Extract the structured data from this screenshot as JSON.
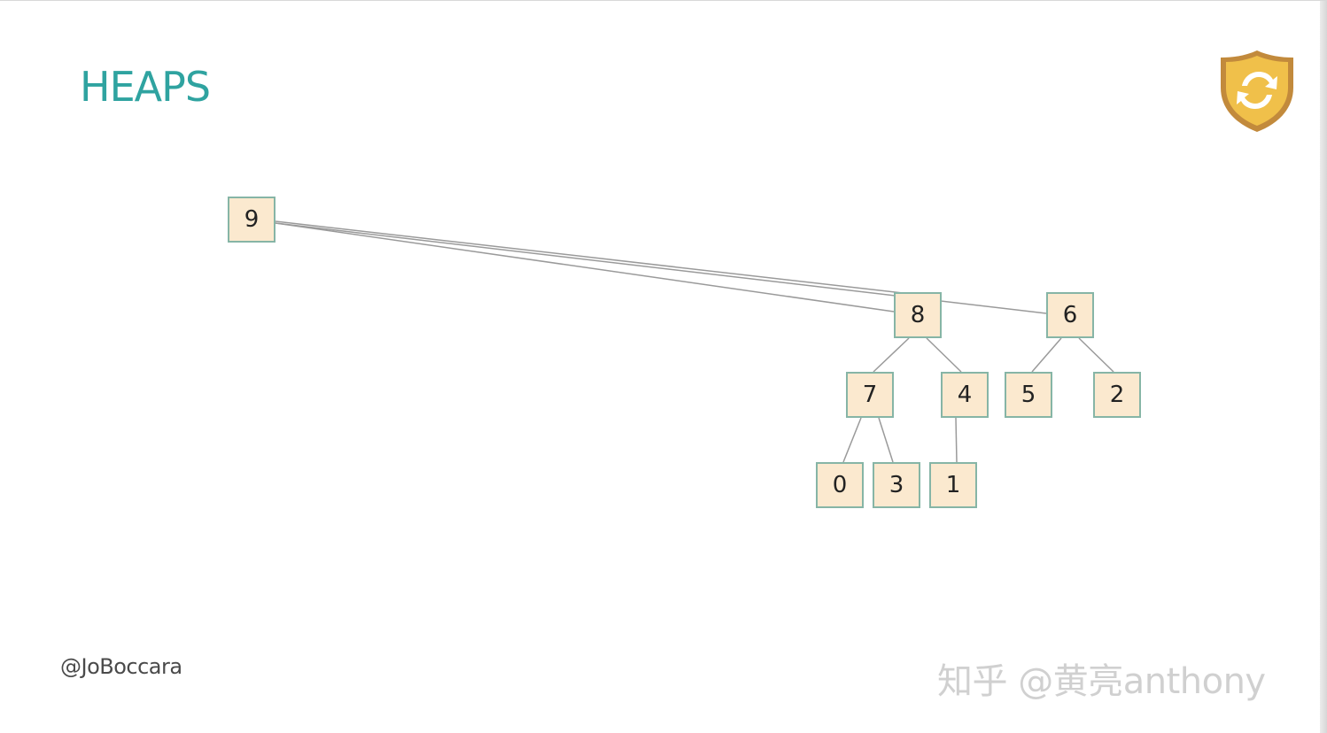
{
  "slide": {
    "title": "HEAPS",
    "handle": "@JoBoccara",
    "watermark": "知乎 @黄亮anthony",
    "logo_icon": "shield-refresh-icon"
  },
  "colors": {
    "title": "#2fa3a0",
    "node_fill": "#fbe9cf",
    "node_border": "#86b5a6",
    "edge": "#9a9a9a",
    "logo_fill": "#f0c04a",
    "logo_border": "#c28a3c"
  },
  "heap": {
    "nodes": [
      {
        "id": "n9",
        "value": "9"
      },
      {
        "id": "n8",
        "value": "8"
      },
      {
        "id": "n6",
        "value": "6"
      },
      {
        "id": "n7",
        "value": "7"
      },
      {
        "id": "n4",
        "value": "4"
      },
      {
        "id": "n5",
        "value": "5"
      },
      {
        "id": "n2",
        "value": "2"
      },
      {
        "id": "n0",
        "value": "0"
      },
      {
        "id": "n3",
        "value": "3"
      },
      {
        "id": "n1",
        "value": "1"
      }
    ],
    "edges": [
      {
        "from": "9",
        "to": "8"
      },
      {
        "from": "9",
        "to": "6"
      },
      {
        "from": "8",
        "to": "7"
      },
      {
        "from": "8",
        "to": "4"
      },
      {
        "from": "6",
        "to": "5"
      },
      {
        "from": "6",
        "to": "2"
      },
      {
        "from": "7",
        "to": "0"
      },
      {
        "from": "7",
        "to": "3"
      },
      {
        "from": "4",
        "to": "1"
      }
    ]
  }
}
